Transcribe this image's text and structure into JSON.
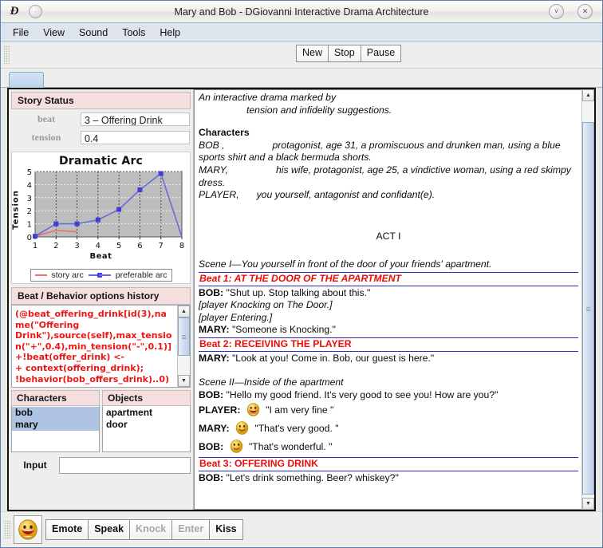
{
  "window": {
    "title": "Mary and Bob  -  DGiovanni Interactive Drama Architecture",
    "app_icon": "Đ",
    "minimize_icon": "˅",
    "close_icon": "✕",
    "system_icon": "·"
  },
  "menubar": {
    "items": [
      "File",
      "View",
      "Sound",
      "Tools",
      "Help"
    ]
  },
  "toolbar": {
    "buttons": [
      "New",
      "Stop",
      "Pause"
    ]
  },
  "story_status": {
    "header": "Story Status",
    "rows": [
      {
        "label": "beat",
        "value": "3 – Offering Drink"
      },
      {
        "label": "tension",
        "value": "0.4"
      }
    ]
  },
  "chart_data": {
    "type": "line",
    "title": "Dramatic Arc",
    "xlabel": "Beat",
    "ylabel": "Tension",
    "x": [
      1,
      2,
      3,
      4,
      5,
      6,
      7,
      8
    ],
    "xlim": [
      1,
      8
    ],
    "ylim": [
      0,
      5
    ],
    "xticks": [
      "1",
      "2",
      "3",
      "4",
      "5",
      "6",
      "7",
      "8"
    ],
    "yticks": [
      "0",
      "1",
      "2",
      "3",
      "4",
      "5"
    ],
    "grid": true,
    "legend_position": "bottom",
    "series": [
      {
        "name": "story arc",
        "color": "#e8726d",
        "markers": false,
        "x": [
          1,
          2,
          3
        ],
        "values": [
          0.05,
          0.5,
          0.4
        ]
      },
      {
        "name": "preferable arc",
        "color": "#6a6ae0",
        "markers": true,
        "x": [
          1,
          2,
          3,
          4,
          5,
          6,
          7,
          8
        ],
        "values": [
          0.05,
          1.0,
          1.0,
          1.3,
          2.1,
          3.6,
          4.85,
          0.0
        ]
      }
    ]
  },
  "behavior_history": {
    "header": "Beat / Behavior options history",
    "text": "(@beat_offering_drink[id(3),name(\"Offering Drink\"),source(self),max_tension(\"+\",0.4),min_tension(\"-\",0.1)]\n+!beat(offer_drink) <-\n+ context(offering_drink);\n!behavior(bob_offers_drink)..0)"
  },
  "characters_panel": {
    "header": "Characters",
    "items": [
      "bob",
      "mary"
    ],
    "selected": [
      "bob",
      "mary"
    ]
  },
  "objects_panel": {
    "header": "Objects",
    "items": [
      "apartment",
      "door"
    ],
    "selected": []
  },
  "input": {
    "label": "Input",
    "value": "",
    "placeholder": ""
  },
  "story": {
    "intro_line1": "An interactive drama marked by",
    "intro_line2": "tension and infidelity suggestions.",
    "characters_heading": "Characters",
    "character_lines": [
      {
        "name": "BOB ,",
        "desc": "protagonist, age 31, a promiscuous and drunken man, using a blue sports shirt and a black bermuda shorts."
      },
      {
        "name": "MARY,",
        "desc": "his wife, protagonist, age 25, a vindictive woman, using a red skimpy dress."
      },
      {
        "name": "PLAYER,",
        "desc": "you yourself, antagonist and confidant(e)."
      }
    ],
    "act_title": "ACT I",
    "scene1": "Scene I—You yourself in front of the door of your friends' apartment.",
    "beat1": "Beat 1: AT THE DOOR OF THE APARTMENT",
    "beat1_lines": [
      {
        "speaker": "BOB:",
        "text": "\"Shut up. Stop talking about this.\"",
        "style": "dialog"
      },
      {
        "speaker": "",
        "text": "[player Knocking on The Door.]",
        "style": "stage"
      },
      {
        "speaker": "",
        "text": "[player Entering.]",
        "style": "stage"
      },
      {
        "speaker": "MARY:",
        "text": "\"Someone is Knocking.\"",
        "style": "dialog"
      }
    ],
    "beat2": "Beat 2: RECEIVING THE PLAYER",
    "beat2_lines": [
      {
        "speaker": "MARY:",
        "text": "\"Look at you! Come in. Bob, our guest is here.\"",
        "style": "dialog"
      }
    ],
    "scene2": "Scene II—Inside of the apartment",
    "scene2_lines": [
      {
        "speaker": "BOB:",
        "text": "\"Hello my good friend. It's very good to see you! How are you?\"",
        "style": "dialog",
        "emoji": ""
      },
      {
        "speaker": "PLAYER:",
        "text": "\"I am very fine \"",
        "style": "dialog",
        "emoji": "grin-emoji"
      },
      {
        "speaker": "MARY:",
        "text": "\"That's very good. \"",
        "style": "dialog",
        "emoji": "smile-emoji"
      },
      {
        "speaker": "BOB:",
        "text": "\"That's wonderful. \"",
        "style": "dialog",
        "emoji": "neutral-smile-emoji"
      }
    ],
    "beat3": "Beat 3: OFFERING DRINK",
    "beat3_lines": [
      {
        "speaker": "BOB:",
        "text": "\"Let's drink something. Beer? whiskey?\"",
        "style": "dialog"
      }
    ]
  },
  "bottom_bar": {
    "emote_icon": "grin-emoji",
    "buttons": [
      {
        "label": "Emote",
        "enabled": true
      },
      {
        "label": "Speak",
        "enabled": true
      },
      {
        "label": "Knock",
        "enabled": false
      },
      {
        "label": "Enter",
        "enabled": false
      },
      {
        "label": "Kiss",
        "enabled": true
      }
    ]
  },
  "colors": {
    "section_header_bg": "#f5dede",
    "beat_text": "#f00b0b",
    "beat_border": "#2b2bc8",
    "behavior_text": "#f01414",
    "selection": "#aec4e2",
    "story_arc": "#e8726d",
    "preferable_arc": "#6a6ae0"
  }
}
